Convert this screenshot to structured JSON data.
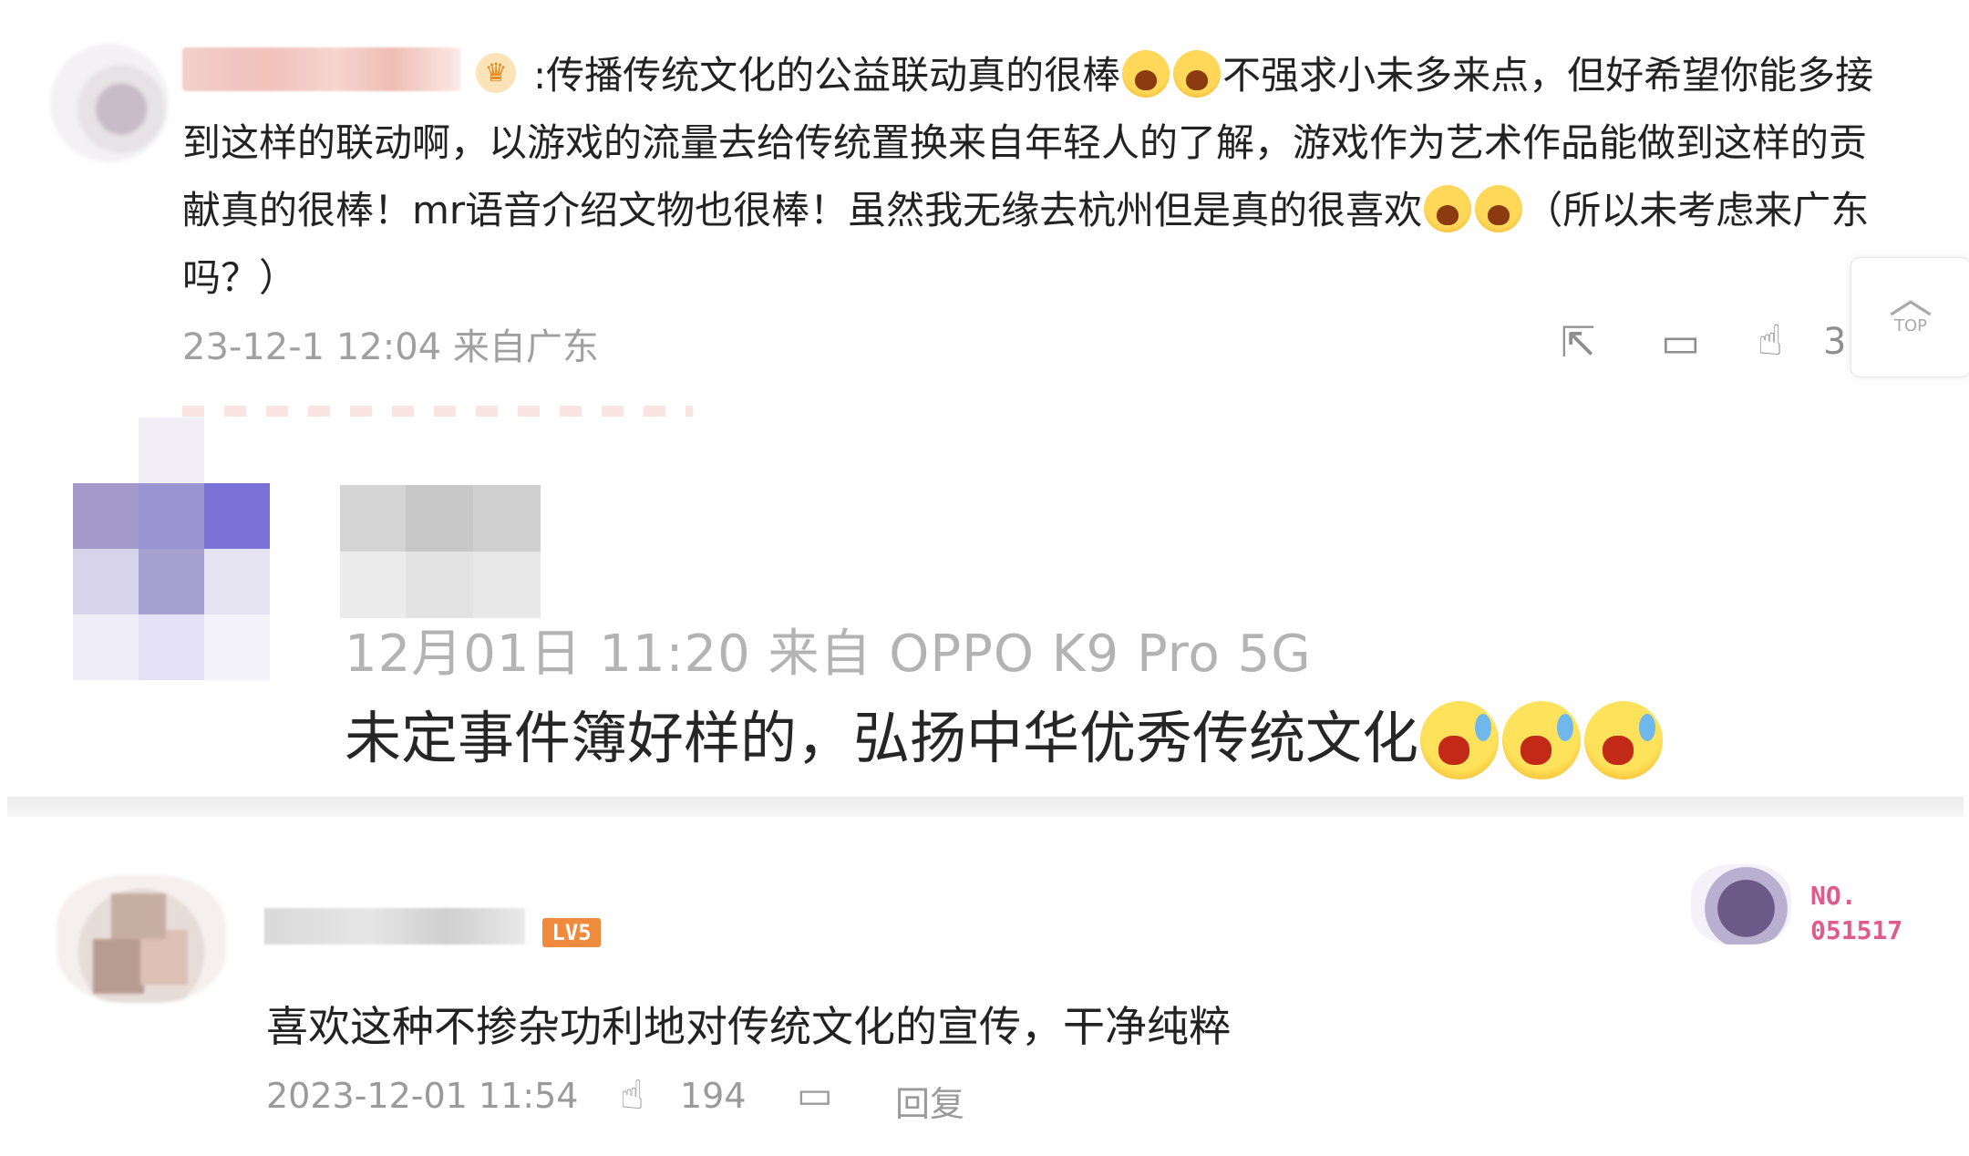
{
  "comment1": {
    "text_part1": ":传播传统文化的公益联动真的很棒",
    "text_part2": "不强求小未多来点，但好希望你能多接到这样的联动啊，以游戏的流量去给传统置换来自年轻人的了解，游戏作为艺术作品能做到这样的贡献真的很棒！mr语音介绍文物也很棒！虽然我无缘去杭州但是真的很喜欢",
    "text_part3": "（所以未考虑来广东吗？）",
    "meta": "23-12-1 12:04 来自广东",
    "like_count": "3",
    "top_label": "TOP"
  },
  "comment2": {
    "meta": "12月01日 11:20  来自 OPPO K9 Pro 5G",
    "text": "未定事件簿好样的，弘扬中华优秀传统文化"
  },
  "comment3": {
    "level": "LV5",
    "text": "喜欢这种不掺杂功利地对传统文化的宣传，干净纯粹",
    "meta": "2023-12-01 11:54",
    "like_count": "194",
    "reply_label": "回复",
    "badge_line1": "NO.",
    "badge_line2": "051517"
  },
  "icons": [
    "share-icon",
    "comment-icon",
    "like-icon",
    "chevron-up-icon"
  ]
}
